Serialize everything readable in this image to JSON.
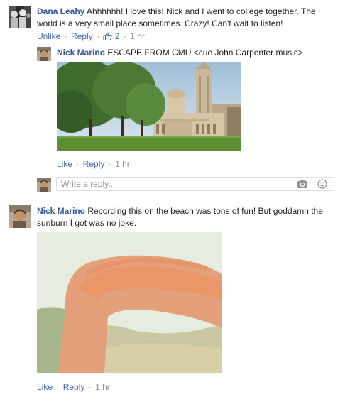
{
  "comments": [
    {
      "author": "Dana Leahy",
      "text": "Ahhhhhh! I love this! Nick and I went to college together. The world is a very small place sometimes. Crazy! Can't wait to listen!",
      "actions": {
        "unlike": "Unlike",
        "reply": "Reply",
        "likes": "2",
        "time": "1 hr"
      },
      "reply": {
        "author": "Nick Marino",
        "text": "ESCAPE FROM CMU <cue John Carpenter music>",
        "actions": {
          "like": "Like",
          "reply": "Reply",
          "time": "1 hr"
        }
      },
      "reply_box": {
        "placeholder": "Write a reply..."
      }
    },
    {
      "author": "Nick Marino",
      "text_line1": "Recording this on the beach was tons of fun! But goddamn the",
      "text_line2": "sunburn I got was no joke.",
      "actions": {
        "like": "Like",
        "reply": "Reply",
        "time": "1 hr"
      }
    }
  ],
  "separator": "·",
  "colors": {
    "name": "#365899",
    "link": "#4267b2",
    "meta": "#90949c",
    "border": "#dddfe2"
  },
  "icons": [
    "thumbs-up-icon",
    "camera-icon",
    "smiley-icon"
  ]
}
